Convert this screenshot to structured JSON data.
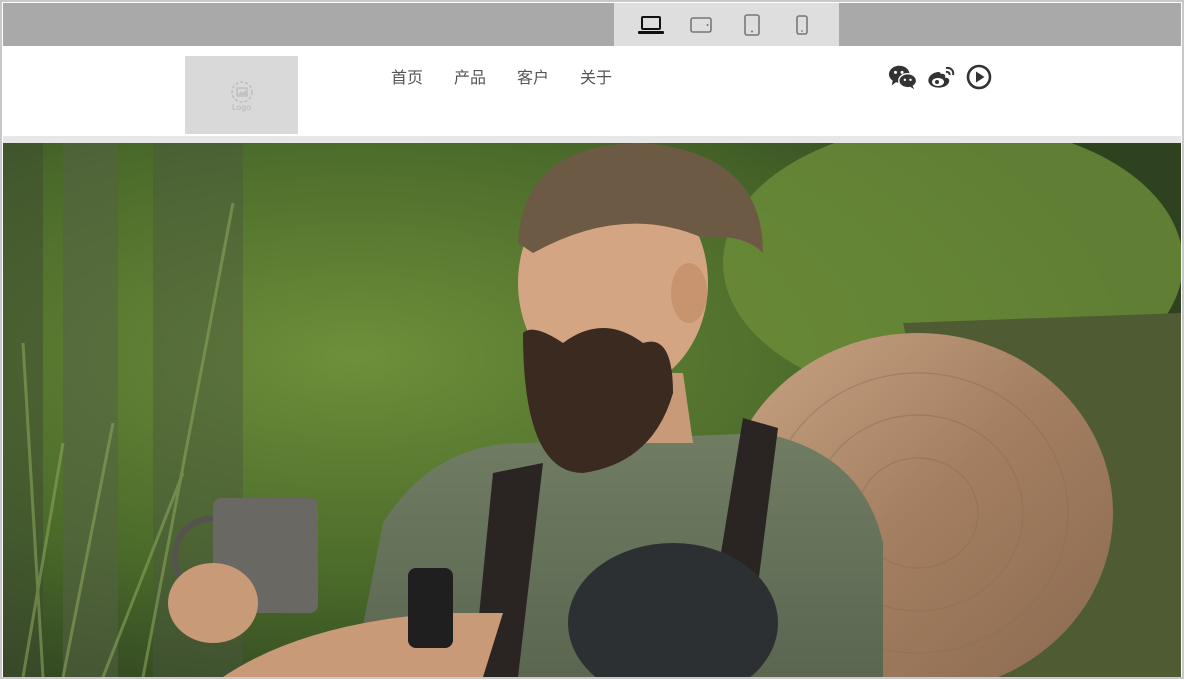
{
  "device_bar": {
    "devices": [
      {
        "name": "desktop",
        "icon": "laptop-icon",
        "active": true
      },
      {
        "name": "tablet-landscape",
        "icon": "tablet-landscape-icon",
        "active": false
      },
      {
        "name": "tablet-portrait",
        "icon": "tablet-portrait-icon",
        "active": false
      },
      {
        "name": "phone",
        "icon": "phone-icon",
        "active": false
      }
    ]
  },
  "header": {
    "logo_text": "Logo",
    "nav": [
      {
        "label": "首页"
      },
      {
        "label": "产品"
      },
      {
        "label": "客户"
      },
      {
        "label": "关于"
      }
    ],
    "social": [
      "wechat-icon",
      "weibo-icon",
      "play-icon"
    ]
  },
  "hero": {
    "image": "bearded-man-holding-mug-leaning-on-log",
    "colors": {
      "foliage": "#5f7a34",
      "shirt": "#6b7760",
      "log": "#b08a6a"
    }
  }
}
